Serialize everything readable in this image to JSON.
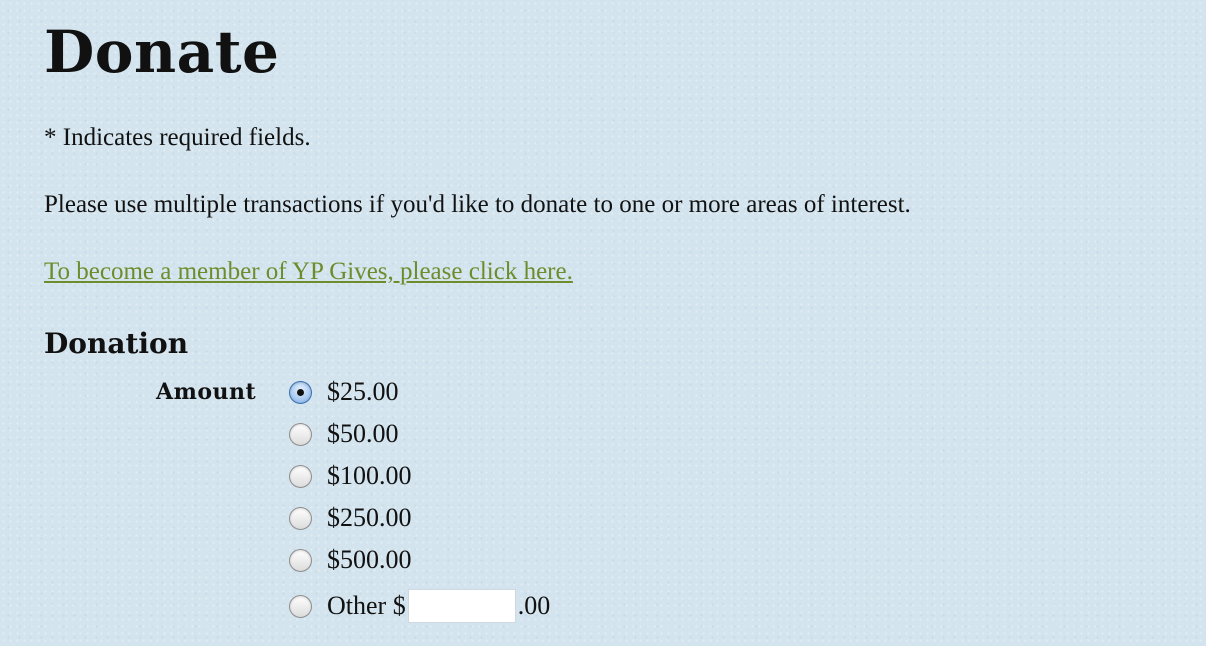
{
  "page": {
    "title": "Donate",
    "required_note": "* Indicates required fields.",
    "multiple_note": "Please use multiple transactions if you'd like to donate to one or more areas of interest.",
    "member_link": "To become a member of YP Gives, please click here."
  },
  "donation": {
    "section_title": "Donation",
    "amount_label": "Amount",
    "selected": "$25.00",
    "options": [
      {
        "label": "$25.00",
        "checked": true
      },
      {
        "label": "$50.00",
        "checked": false
      },
      {
        "label": "$100.00",
        "checked": false
      },
      {
        "label": "$250.00",
        "checked": false
      },
      {
        "label": "$500.00",
        "checked": false
      }
    ],
    "other": {
      "label": "Other $",
      "value": "",
      "suffix": ".00",
      "checked": false
    }
  },
  "colors": {
    "background": "#d3e4ee",
    "link": "#6e8c2c",
    "text": "#111111"
  }
}
